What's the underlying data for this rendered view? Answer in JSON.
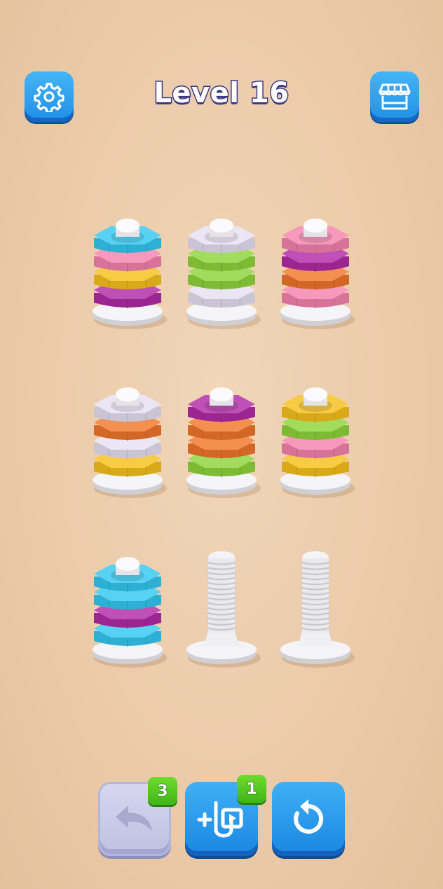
{
  "header": {
    "level_label": "Level 16",
    "settings_icon": "gear-icon",
    "shop_icon": "shop-icon"
  },
  "colors": {
    "cyan": "#33c8f0",
    "pink": "#f482ad",
    "yellow": "#f6c01b",
    "magenta": "#b12aa6",
    "lavender": "#e6e0f2",
    "green": "#8ed43c",
    "orange": "#f0762b"
  },
  "bolts": [
    {
      "row": 0,
      "col": 0,
      "nuts": [
        "magenta",
        "yellow",
        "pink",
        "cyan"
      ]
    },
    {
      "row": 0,
      "col": 1,
      "nuts": [
        "lavender",
        "green",
        "green",
        "lavender"
      ]
    },
    {
      "row": 0,
      "col": 2,
      "nuts": [
        "pink",
        "orange",
        "magenta",
        "pink"
      ]
    },
    {
      "row": 1,
      "col": 0,
      "nuts": [
        "yellow",
        "lavender",
        "orange",
        "lavender"
      ]
    },
    {
      "row": 1,
      "col": 1,
      "nuts": [
        "green",
        "orange",
        "orange",
        "magenta"
      ]
    },
    {
      "row": 1,
      "col": 2,
      "nuts": [
        "yellow",
        "pink",
        "green",
        "yellow"
      ]
    },
    {
      "row": 2,
      "col": 0,
      "nuts": [
        "cyan",
        "magenta",
        "cyan",
        "cyan"
      ]
    },
    {
      "row": 2,
      "col": 1,
      "nuts": []
    },
    {
      "row": 2,
      "col": 2,
      "nuts": []
    }
  ],
  "controls": {
    "undo": {
      "count": "3",
      "icon": "undo-icon",
      "enabled": false
    },
    "add_bolt": {
      "count": "1",
      "icon": "add-bolt-video-icon",
      "enabled": true
    },
    "restart": {
      "icon": "restart-icon",
      "enabled": true
    }
  }
}
